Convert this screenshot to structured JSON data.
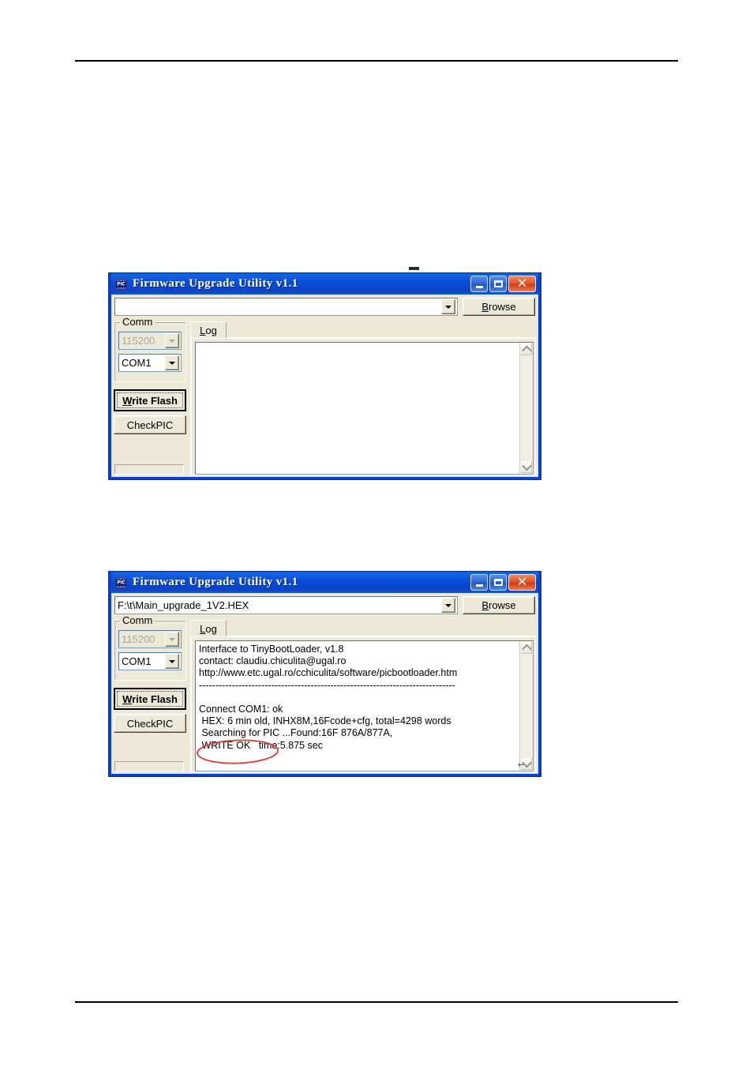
{
  "document": {
    "header_rule": true,
    "footer_rule": true
  },
  "windows": [
    {
      "id": "before",
      "title": "Firmware Upgrade Utility v1.1",
      "icon": "pic-chip-icon",
      "icon_text": "PIC",
      "titlebar_buttons": {
        "minimize": "minimize-icon",
        "maximize": "maximize-icon",
        "close": "close-icon"
      },
      "file_combo": {
        "value": "",
        "placeholder": "",
        "dropdown_icon": "chevron-down-icon"
      },
      "browse_button": {
        "label": "Browse",
        "accel": "B"
      },
      "comm_group": {
        "title": "Comm",
        "baud_combo": {
          "value": "115200",
          "disabled": true
        },
        "port_combo": {
          "value": "COM1",
          "disabled": false
        }
      },
      "write_flash_button": {
        "label": "Write Flash",
        "accel": "W",
        "focused": true
      },
      "checkpic_button": {
        "label": "CheckPIC"
      },
      "progress_bar": {
        "value": 0
      },
      "tabs": [
        {
          "label": "Log",
          "accel": "L",
          "active": true
        }
      ],
      "log": {
        "lines": [],
        "text": "",
        "return_mark": ""
      },
      "scrollbar": {
        "up_icon": "chevron-up-icon",
        "down_icon": "chevron-down-icon"
      },
      "annotation": null
    },
    {
      "id": "after",
      "title": "Firmware Upgrade Utility v1.1",
      "icon": "pic-chip-icon",
      "icon_text": "PIC",
      "titlebar_buttons": {
        "minimize": "minimize-icon",
        "maximize": "maximize-icon",
        "close": "close-icon"
      },
      "file_combo": {
        "value": "F:\\t\\Main_upgrade_1V2.HEX",
        "placeholder": "",
        "dropdown_icon": "chevron-down-icon"
      },
      "browse_button": {
        "label": "Browse",
        "accel": "B"
      },
      "comm_group": {
        "title": "Comm",
        "baud_combo": {
          "value": "115200",
          "disabled": true
        },
        "port_combo": {
          "value": "COM1",
          "disabled": false
        }
      },
      "write_flash_button": {
        "label": "Write Flash",
        "accel": "W",
        "focused": true
      },
      "checkpic_button": {
        "label": "CheckPIC"
      },
      "progress_bar": {
        "value": 0
      },
      "tabs": [
        {
          "label": "Log",
          "accel": "L",
          "active": true
        }
      ],
      "log": {
        "lines": [
          "Interface to TinyBootLoader, v1.8",
          "contact: claudiu.chiculita@ugal.ro",
          "http://www.etc.ugal.ro/cchiculita/software/picbootloader.htm",
          "------------------------------------------------------------------------------",
          "",
          "Connect COM1: ok",
          " HEX: 6 min old, INHX8M,16Fcode+cfg, total=4298 words",
          " Searching for PIC ...Found:16F 876A/877A,",
          " WRITE OK   time:5.875 sec"
        ],
        "text": "Interface to TinyBootLoader, v1.8\ncontact: claudiu.chiculita@ugal.ro\nhttp://www.etc.ugal.ro/cchiculita/software/picbootloader.htm\n------------------------------------------------------------------------------\n\nConnect COM1: ok\n HEX: 6 min old, INHX8M,16Fcode+cfg, total=4298 words\n Searching for PIC ...Found:16F 876A/877A,\n WRITE OK   time:5.875 sec",
        "return_mark": "↵"
      },
      "scrollbar": {
        "up_icon": "chevron-up-icon",
        "down_icon": "chevron-down-icon"
      },
      "annotation": {
        "type": "ellipse",
        "target_text": "WRITE OK",
        "color": "#e03a3a"
      }
    }
  ],
  "colors": {
    "titlebar_blue": "#0a4fd6",
    "window_border": "#0a3fd4",
    "client_face": "#ece9d8",
    "field_white": "#ffffff",
    "annotation_red": "#e03a3a",
    "disabled_text": "#aca899"
  }
}
